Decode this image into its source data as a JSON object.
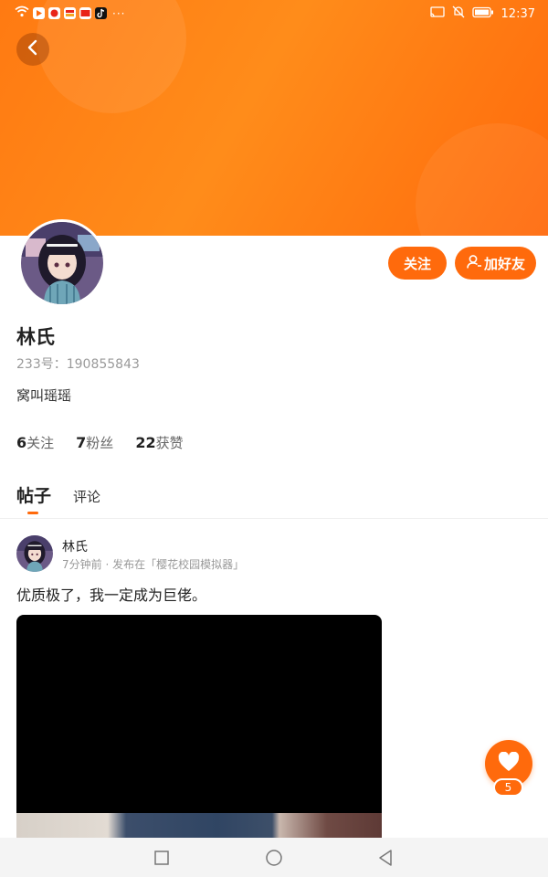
{
  "status_bar": {
    "time": "12:37",
    "overflow": "···",
    "left_icons": [
      "wifi-icon",
      "app-icon-1",
      "app-icon-2",
      "app-icon-3",
      "app-icon-4",
      "tiktok-icon"
    ],
    "right_icons": [
      "cast-icon",
      "mute-bell-icon",
      "battery-icon"
    ]
  },
  "colors": {
    "accent": "#ff6a0c",
    "banner_start": "#ff7a12",
    "banner_end": "#ff6a0c"
  },
  "profile": {
    "name": "林氏",
    "uid": "233号：190855843",
    "bio": "窝叫瑶瑶",
    "follow_button": "关注",
    "add_friend_button": "加好友"
  },
  "stats": [
    {
      "count": "6",
      "label": "关注"
    },
    {
      "count": "7",
      "label": "粉丝"
    },
    {
      "count": "22",
      "label": "获赞"
    }
  ],
  "tabs": [
    {
      "label": "帖子",
      "active": true
    },
    {
      "label": "评论",
      "active": false
    }
  ],
  "post": {
    "author": "林氏",
    "meta": "7分钟前 · 发布在「樱花校园模拟器」",
    "text": "优质极了，我一定成为巨佬。",
    "likes": "5"
  },
  "nav": [
    "square-icon",
    "circle-icon",
    "triangle-back-icon"
  ]
}
